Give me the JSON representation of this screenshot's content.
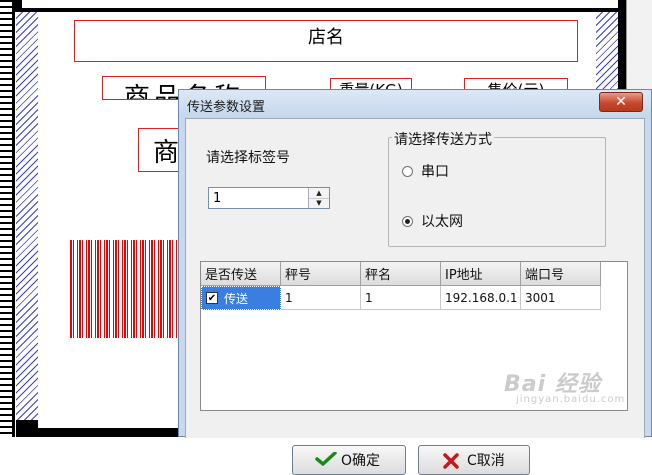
{
  "designer": {
    "store_name": "店名",
    "product_name": "商品名称",
    "weight_label": "重量(KG)",
    "price_label": "售价(元)",
    "product_partial": "商"
  },
  "dialog": {
    "title": "传送参数设置",
    "close_glyph": "✕",
    "tag_label": "请选择标签号",
    "tag_value": "1",
    "transfer_group_title": "请选择传送方式",
    "radio_serial": "串口",
    "radio_ethernet": "以太网",
    "selected_transfer": "以太网",
    "table": {
      "headers": [
        "是否传送",
        "秤号",
        "秤名",
        "IP地址",
        "端口号"
      ],
      "rows": [
        {
          "send": "传送",
          "checked": true,
          "scale_no": "1",
          "scale_name": "1",
          "ip": "192.168.0.1",
          "port": "3001"
        }
      ]
    },
    "ok_label": "O确定",
    "cancel_label": "C取消"
  },
  "watermark": {
    "main": "Bai 经验",
    "sub": "jingyan.baidu.com"
  },
  "colors": {
    "accent_red": "#dd2222",
    "selection_blue": "#3a7ee0",
    "close_red": "#c74a2e"
  }
}
